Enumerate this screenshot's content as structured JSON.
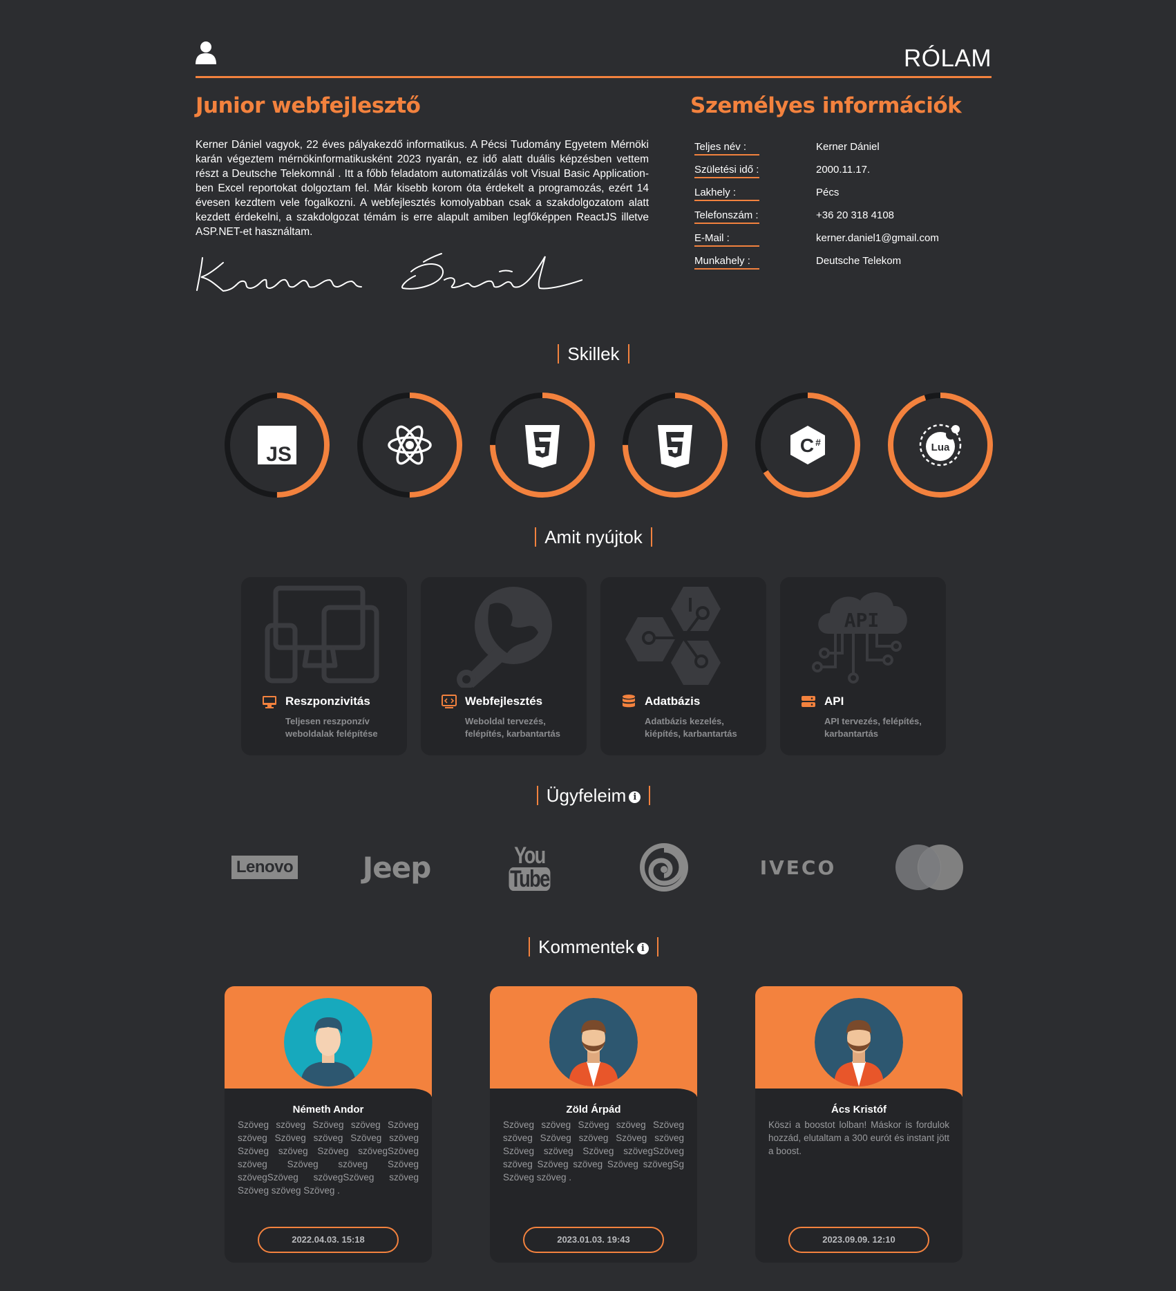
{
  "header": {
    "title": "RÓLAM",
    "user_icon": "user-icon"
  },
  "about": {
    "title": "Junior webfejlesztő",
    "text": "Kerner Dániel vagyok, 22 éves pályakezdő informatikus. A Pécsi Tudomány Egyetem Mérnöki karán végeztem mérnökinformatikusként 2023 nyarán, ez idő alatt duális képzésben vettem részt a Deutsche Telekomnál . Itt a főbb feladatom automatizálás volt Visual Basic Application-ben Excel reportokat dolgoztam fel. Már kisebb korom óta érdekelt a programozás, ezért 14 évesen kezdtem vele fogalkozni. A webfejlesztés komolyabban csak a szakdolgozatom alatt kezdett érdekelni, a szakdolgozat témám is erre alapult amiben legfőképpen ReactJS illetve ASP.NET-et használtam.",
    "signature": "Kerner Dániel"
  },
  "personal": {
    "title": "Személyes információk",
    "rows": [
      {
        "label": "Teljes név :",
        "value": "Kerner Dániel"
      },
      {
        "label": "Születési idő :",
        "value": "2000.11.17."
      },
      {
        "label": "Lakhely :",
        "value": "Pécs"
      },
      {
        "label": "Telefonszám :",
        "value": "+36 20 318 4108"
      },
      {
        "label": "E-Mail :",
        "value": "kerner.daniel1@gmail.com"
      },
      {
        "label": "Munkahely :",
        "value": "Deutsche Telekom"
      }
    ]
  },
  "skills": {
    "title": "Skillek",
    "items": [
      {
        "name": "javascript-icon",
        "level": 0.5
      },
      {
        "name": "react-icon",
        "level": 0.5
      },
      {
        "name": "css3-icon",
        "level": 0.75
      },
      {
        "name": "html5-icon",
        "level": 0.75
      },
      {
        "name": "csharp-icon",
        "level": 0.66
      },
      {
        "name": "lua-icon",
        "level": 0.95
      }
    ]
  },
  "services": {
    "title": "Amit nyújtok",
    "items": [
      {
        "name": "Reszponzivitás",
        "desc": "Teljesen reszponzív weboldalak felépítése",
        "icon": "monitor-icon"
      },
      {
        "name": "Webfejlesztés",
        "desc": "Weboldal tervezés, felépítés, karbantartás",
        "icon": "code-monitor-icon"
      },
      {
        "name": "Adatbázis",
        "desc": "Adatbázis kezelés, kiépítés, karbantartás",
        "icon": "database-icon"
      },
      {
        "name": "API",
        "desc": "API tervezés, felépítés, karbantartás",
        "icon": "server-icon"
      }
    ]
  },
  "clients": {
    "title": "Ügyfeleim",
    "info": "i",
    "logos": [
      {
        "name": "lenovo-logo",
        "text": "Lenovo"
      },
      {
        "name": "jeep-logo",
        "text": "Jeep"
      },
      {
        "name": "youtube-logo",
        "text_top": "You",
        "text_bottom": "Tube"
      },
      {
        "name": "ubisoft-logo"
      },
      {
        "name": "iveco-logo",
        "text": "IVECO"
      },
      {
        "name": "mastercard-logo"
      }
    ]
  },
  "comments": {
    "title": "Kommentek",
    "info": "i",
    "items": [
      {
        "name": "Németh Andor",
        "text": "Szöveg szöveg Szöveg szöveg Szöveg szöveg Szöveg szöveg Szöveg szöveg Szöveg szöveg Szöveg szövegSzöveg szöveg Szöveg szöveg Szöveg szövegSzöveg szövegSzöveg szöveg Szöveg szöveg Szöveg .",
        "date": "2022.04.03. 15:18",
        "avatar_bg": "#17a9bd"
      },
      {
        "name": "Zöld Árpád",
        "text": "Szöveg szöveg Szöveg szöveg Szöveg szöveg Szöveg szöveg Szöveg szöveg Szöveg szöveg Szöveg szövegSzöveg szöveg Szöveg szöveg Szöveg szövegSg Szöveg szöveg .",
        "date": "2023.01.03. 19:43",
        "avatar_bg": "#2d5770"
      },
      {
        "name": "Ács Kristóf",
        "text": "Köszi a boostot lolban! Máskor is fordulok hozzád, elutaltam a 300 eurót és instant jött a boost.",
        "date": "2023.09.09. 12:10",
        "avatar_bg": "#2d5770"
      }
    ]
  },
  "colors": {
    "accent": "#f3823e",
    "background": "#2c2d30",
    "card": "#242528",
    "muted": "#8c8d90"
  }
}
